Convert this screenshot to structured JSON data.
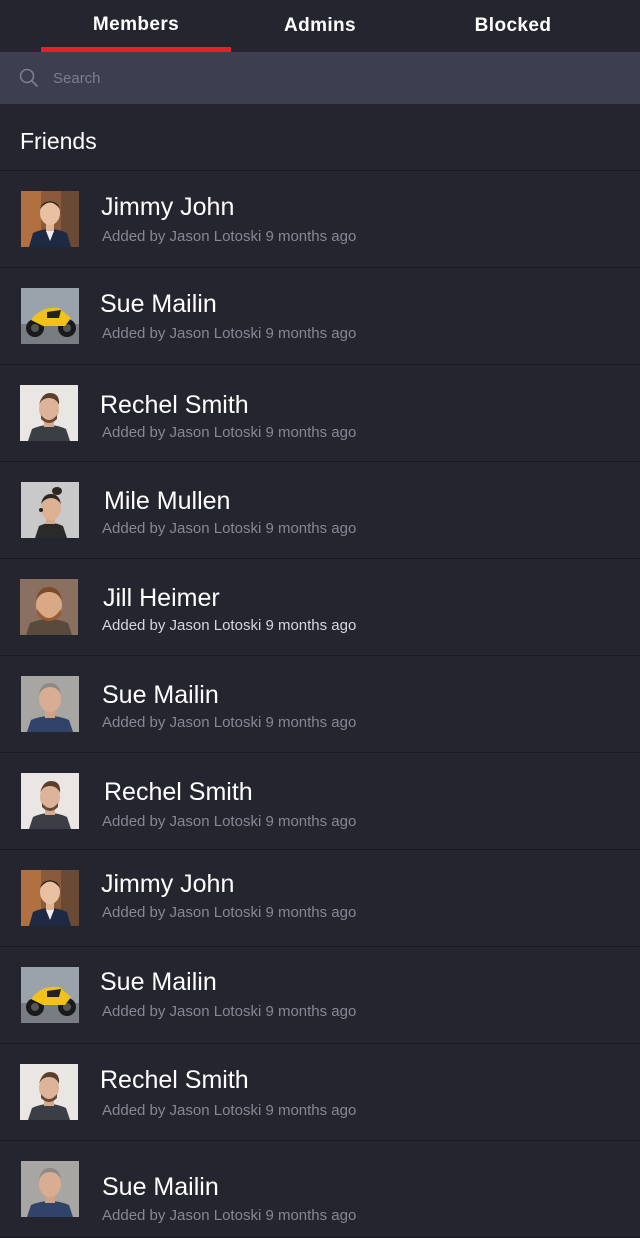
{
  "tabs": [
    {
      "label": "Members",
      "active": true
    },
    {
      "label": "Admins",
      "active": false
    },
    {
      "label": "Blocked",
      "active": false
    }
  ],
  "search": {
    "placeholder": "Search",
    "icon": "search-icon"
  },
  "section": {
    "title": "Friends"
  },
  "members": [
    {
      "name": "Jimmy John",
      "subtitle": "Added by Jason Lotoski 9 months ago",
      "avatar": "man-suit-avatar"
    },
    {
      "name": "Sue Mailin",
      "subtitle": "Added by Jason Lotoski 9 months ago",
      "avatar": "motorcycle-avatar"
    },
    {
      "name": "Rechel Smith",
      "subtitle": "Added by Jason Lotoski 9 months ago",
      "avatar": "man-scarf-avatar"
    },
    {
      "name": "Mile Mullen",
      "subtitle": "Added by Jason Lotoski 9 months ago",
      "avatar": "man-topknot-avatar"
    },
    {
      "name": "Jill Heimer",
      "subtitle": "Added by Jason Lotoski 9 months ago",
      "avatar": "man-beard-avatar"
    },
    {
      "name": "Sue Mailin",
      "subtitle": "Added by Jason Lotoski 9 months ago",
      "avatar": "man-grey-hair-avatar"
    },
    {
      "name": "Rechel Smith",
      "subtitle": "Added by Jason Lotoski 9 months ago",
      "avatar": "man-scarf-avatar"
    },
    {
      "name": "Jimmy John",
      "subtitle": "Added by Jason Lotoski 9 months ago",
      "avatar": "man-suit-avatar"
    },
    {
      "name": "Sue Mailin",
      "subtitle": "Added by Jason Lotoski 9 months ago",
      "avatar": "motorcycle-avatar"
    },
    {
      "name": "Rechel Smith",
      "subtitle": "Added by Jason Lotoski 9 months ago",
      "avatar": "man-scarf-avatar"
    },
    {
      "name": "Sue Mailin",
      "subtitle": "Added by Jason Lotoski 9 months ago",
      "avatar": "man-grey-hair-avatar"
    }
  ],
  "colors": {
    "background": "#25252f",
    "search_bar": "#3d3e50",
    "accent": "#e5202a",
    "subtitle": "#868795"
  }
}
